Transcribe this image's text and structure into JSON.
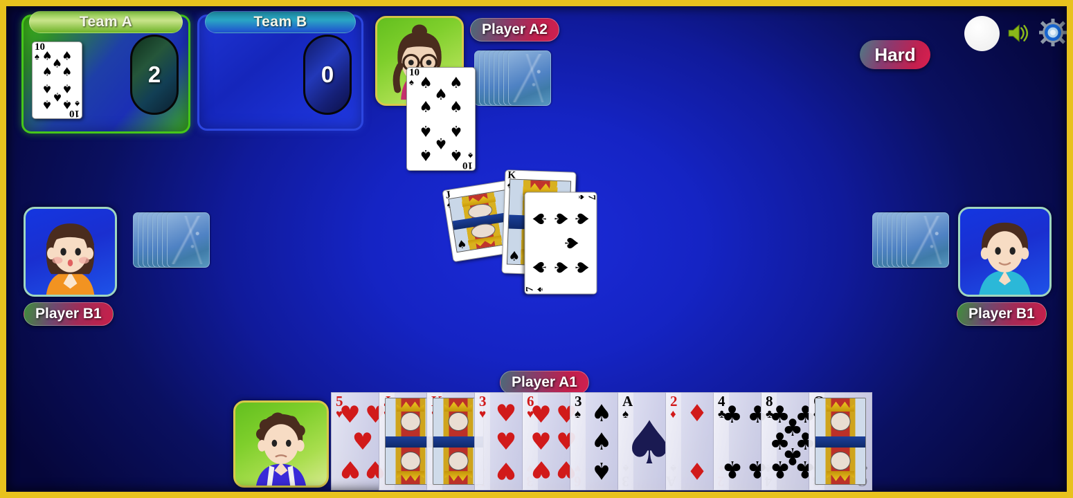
{
  "app": {
    "title": "Card Game Table",
    "frame_color": "#e8c21e",
    "table_color": "#1b2bd8"
  },
  "teams": [
    {
      "id": "team-a",
      "label": "Team A",
      "score": "2",
      "accent": "#46c61a",
      "captured_cards": [
        {
          "rank": "10",
          "suit": "spades",
          "suit_glyph": "♠",
          "color": "black"
        }
      ]
    },
    {
      "id": "team-b",
      "label": "Team B",
      "score": "0",
      "accent": "#2c46e0",
      "captured_cards": []
    }
  ],
  "difficulty": {
    "label": "Hard"
  },
  "controls": {
    "avatar_toggle": "avatar-circle",
    "sound": "sound-on-icon",
    "settings": "gear-icon"
  },
  "players": {
    "top": {
      "name": "Player A2",
      "team": "A",
      "avatar": "girl-glasses-bun",
      "avatar_bg": "green",
      "cards_in_hand": "8"
    },
    "left": {
      "name": "Player B1",
      "team": "B",
      "avatar": "woman-bob-orange",
      "avatar_bg": "blue",
      "cards_in_hand": "8"
    },
    "right": {
      "name": "Player B1",
      "team": "B",
      "avatar": "boy-cyan-shirt",
      "avatar_bg": "blue",
      "cards_in_hand": "8"
    },
    "bottom": {
      "name": "Player A1",
      "team": "A",
      "avatar": "boy-curly-overalls",
      "avatar_bg": "green"
    }
  },
  "played_cards": {
    "top": {
      "rank": "10",
      "suit": "spades",
      "suit_glyph": "♠",
      "color": "black",
      "rotation": "0"
    },
    "left": {
      "rank": "J",
      "suit": "spades",
      "suit_glyph": "♠",
      "color": "black",
      "rotation": "-9"
    },
    "center": {
      "rank": "K",
      "suit": "spades",
      "suit_glyph": "♠",
      "color": "black",
      "rotation": "2"
    },
    "right": {
      "rank": "7",
      "suit": "spades",
      "suit_glyph": "♠",
      "color": "black",
      "rotation": "90"
    }
  },
  "hand": {
    "owner": "Player A1",
    "count": 11,
    "cards": [
      {
        "rank": "5",
        "suit": "hearts",
        "suit_glyph": "♥",
        "color": "red"
      },
      {
        "rank": "J",
        "suit": "hearts",
        "suit_glyph": "♥",
        "color": "red"
      },
      {
        "rank": "K",
        "suit": "hearts",
        "suit_glyph": "♥",
        "color": "red"
      },
      {
        "rank": "3",
        "suit": "hearts",
        "suit_glyph": "♥",
        "color": "red"
      },
      {
        "rank": "6",
        "suit": "hearts",
        "suit_glyph": "♥",
        "color": "red"
      },
      {
        "rank": "3",
        "suit": "spades",
        "suit_glyph": "♠",
        "color": "black"
      },
      {
        "rank": "A",
        "suit": "spades",
        "suit_glyph": "♠",
        "color": "black"
      },
      {
        "rank": "2",
        "suit": "diamonds",
        "suit_glyph": "♦",
        "color": "red"
      },
      {
        "rank": "4",
        "suit": "clubs",
        "suit_glyph": "♣",
        "color": "black"
      },
      {
        "rank": "8",
        "suit": "clubs",
        "suit_glyph": "♣",
        "color": "black"
      },
      {
        "rank": "Q",
        "suit": "clubs",
        "suit_glyph": "♣",
        "color": "black"
      }
    ]
  }
}
